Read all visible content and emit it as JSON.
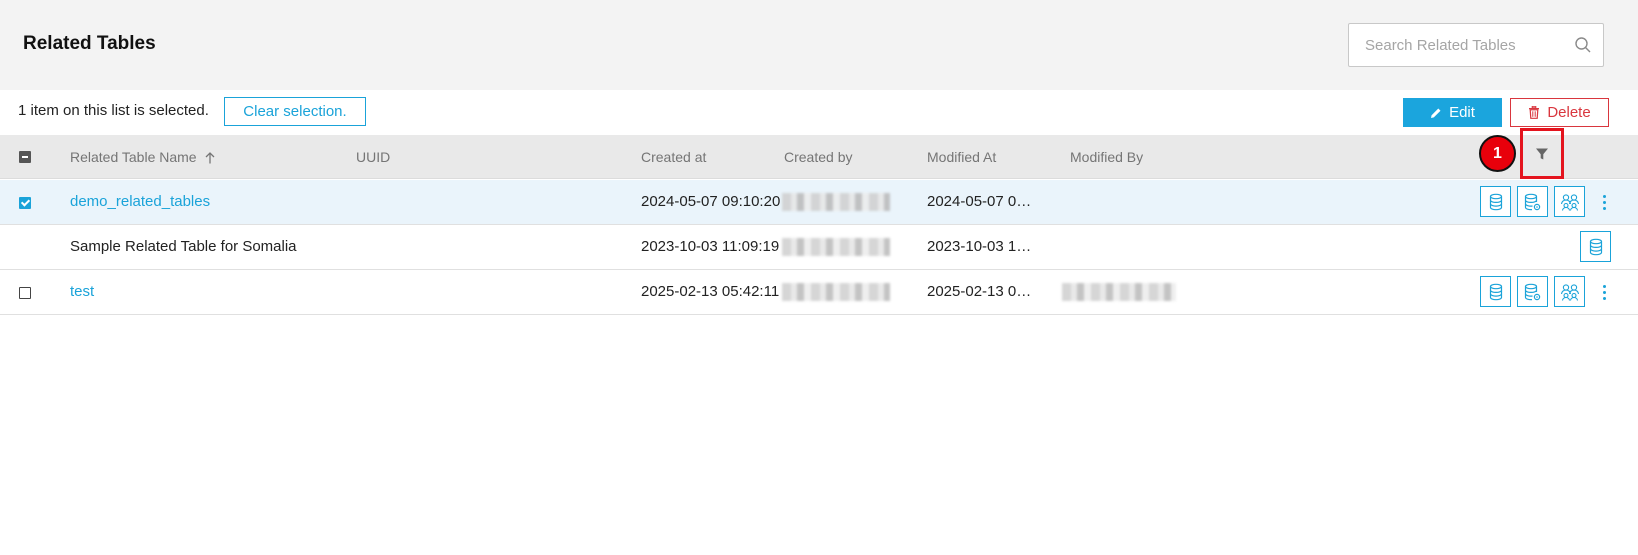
{
  "header": {
    "title": "Related Tables",
    "search_placeholder": "Search Related Tables"
  },
  "selection": {
    "text": "1 item on this list is selected.",
    "clear_label": "Clear selection."
  },
  "toolbar": {
    "edit_label": "Edit",
    "delete_label": "Delete"
  },
  "columns": {
    "name": "Related Table Name",
    "uuid": "UUID",
    "created_at": "Created at",
    "created_by": "Created by",
    "modified_at": "Modified At",
    "modified_by": "Modified By"
  },
  "filter_badge": "1",
  "rows": [
    {
      "name": "demo_related_tables",
      "created_at": "2024-05-07 09:10:20",
      "modified_at": "2024-05-07 0…",
      "selected": true,
      "is_link": true
    },
    {
      "name": "Sample Related Table for Somalia",
      "created_at": "2023-10-03 11:09:19",
      "modified_at": "2023-10-03 1…",
      "selected": false,
      "is_link": false
    },
    {
      "name": "test",
      "created_at": "2025-02-13 05:42:11",
      "modified_at": "2025-02-13 0…",
      "selected": false,
      "is_link": true
    }
  ],
  "colors": {
    "accent": "#1aa3d9",
    "danger": "#d9363e",
    "highlight": "#e4141e",
    "header_bg": "#f3f3f3",
    "table_header_bg": "#e9e9e9",
    "selected_row_bg": "#eaf4fb"
  },
  "icons": {
    "search": "search-icon",
    "sort": "arrow-up-icon",
    "filter": "filter-icon",
    "edit": "pencil-icon",
    "delete": "trash-icon",
    "database": "database-icon",
    "database_settings": "database-gear-icon",
    "users": "users-icon",
    "more": "kebab-icon"
  }
}
